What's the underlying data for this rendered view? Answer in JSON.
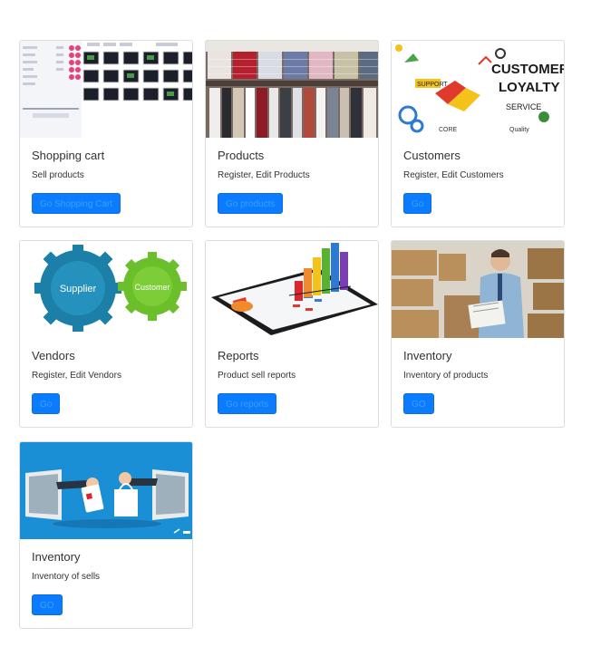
{
  "cards": [
    {
      "title": "Shopping cart",
      "desc": "Sell products",
      "button": "Go Shopping Cart",
      "image": "shopping-cart-screenshot-image"
    },
    {
      "title": "Products",
      "desc": "Register, Edit Products",
      "button": "Go products",
      "image": "clothes-shelf-image"
    },
    {
      "title": "Customers",
      "desc": "Register, Edit Customers",
      "button": "Go",
      "image": "customer-loyalty-image",
      "image_text": {
        "big1": "CUSTOMER",
        "big2": "LOYALTY",
        "support": "SUPPORT",
        "service": "SERVICE",
        "core": "CORE",
        "quality": "Quality"
      }
    },
    {
      "title": "Vendors",
      "desc": "Register, Edit Vendors",
      "button": "Go",
      "image": "supplier-customer-gears-image",
      "image_text": {
        "left": "Supplier",
        "right": "Customer"
      }
    },
    {
      "title": "Reports",
      "desc": "Product sell reports",
      "button": "Go reports",
      "image": "tablet-bar-chart-image"
    },
    {
      "title": "Inventory",
      "desc": "Inventory of products",
      "button": "GO",
      "image": "warehouse-worker-image"
    },
    {
      "title": "Inventory",
      "desc": "Inventory of sells",
      "button": "GO",
      "image": "online-shopping-hands-image"
    }
  ],
  "colors": {
    "button": "#0b7cff",
    "button_text": "#3aa0ff",
    "border": "#dddddd",
    "text": "#333333"
  }
}
